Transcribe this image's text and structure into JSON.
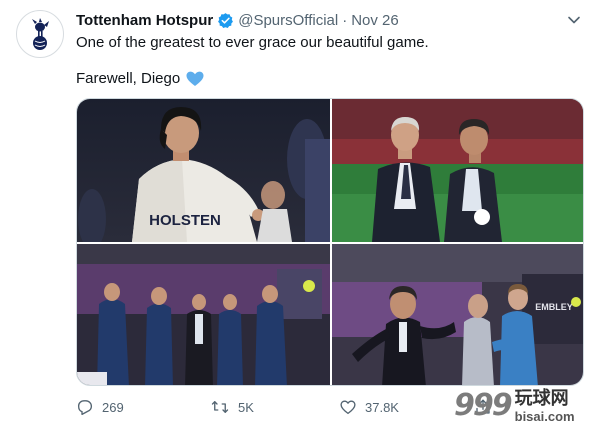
{
  "tweet": {
    "author_name": "Tottenham Hotspur",
    "handle": "@SpursOfficial",
    "separator": "·",
    "date": "Nov 26",
    "line1": "One of the greatest to ever grace our beautiful game.",
    "line2": "Farewell, Diego",
    "icons": {
      "avatar": "spurs-cockerel-logo",
      "verified": "verified-badge-icon",
      "menu": "chevron-down-icon",
      "emoji": "blue-heart-emoji"
    }
  },
  "photos": [
    {
      "name": "photo-maradona-tottenham-shirt",
      "shirt_text": "HOLSTEN"
    },
    {
      "name": "photo-maradona-with-man-stadium"
    },
    {
      "name": "photo-maradona-team-group"
    },
    {
      "name": "photo-maradona-dressing-room",
      "sign_text": "EMBLEY"
    }
  ],
  "actions": {
    "reply_count": "269",
    "retweet_count": "5K",
    "like_count": "37.8K"
  },
  "watermark": {
    "numerals": "999",
    "chinese": "玩球网",
    "site": "bisai.com"
  },
  "colors": {
    "verified": "#1d9bf0",
    "text": "#0f1419",
    "secondary": "#536471",
    "heart": "#5dadec"
  }
}
